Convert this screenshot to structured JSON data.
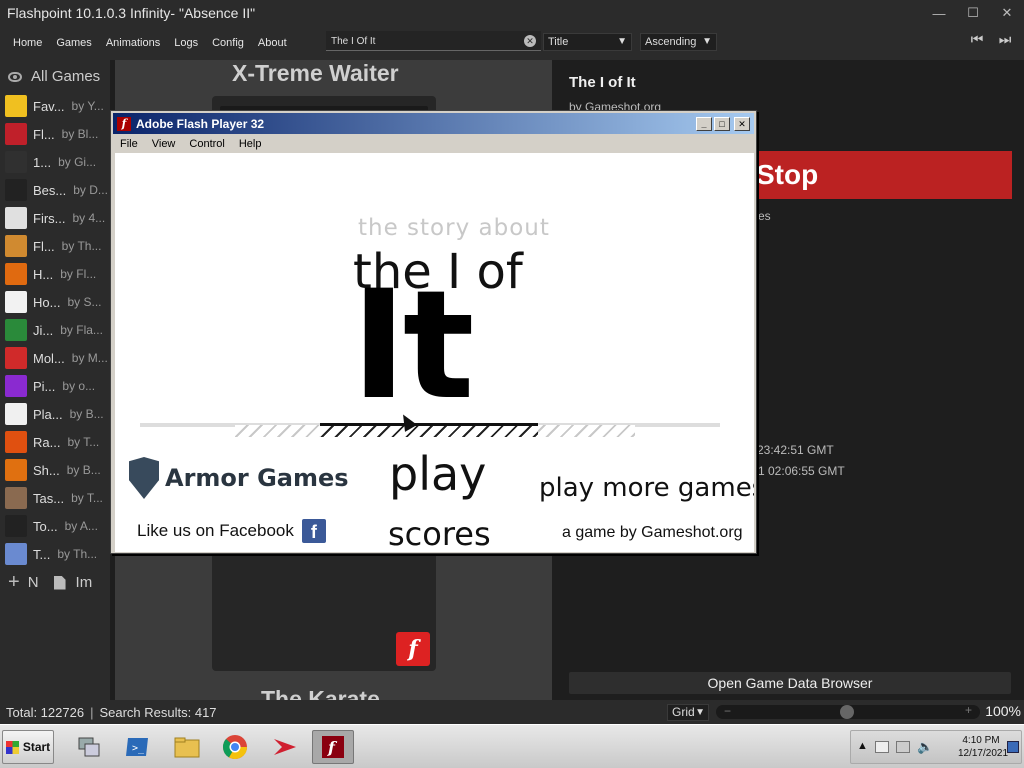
{
  "window": {
    "title": "Flashpoint 10.1.0.3 Infinity- \"Absence II\""
  },
  "menu": {
    "items": [
      "Home",
      "Games",
      "Animations",
      "Logs",
      "Config",
      "About"
    ],
    "search_value": "The I Of It",
    "sort_field": "Title",
    "sort_order": "Ascending"
  },
  "sidebar": {
    "all_games": "All Games",
    "playlists": [
      {
        "name": "Fav...",
        "by": "by Y...",
        "icon": "star-icon",
        "color": "#f0c020"
      },
      {
        "name": "Fl...",
        "by": "by Bl...",
        "icon": "flashpoint-icon",
        "color": "#c0202a"
      },
      {
        "name": "1...",
        "by": "by Gi...",
        "icon": "invader-icon",
        "color": "#303030"
      },
      {
        "name": "Bes...",
        "by": "by D...",
        "icon": "as-icon",
        "color": "#222222"
      },
      {
        "name": "Firs...",
        "by": "by 4...",
        "icon": "number-one-icon",
        "color": "#e0e0e0"
      },
      {
        "name": "Fl...",
        "by": "by Th...",
        "icon": "burger-icon",
        "color": "#d08a30"
      },
      {
        "name": "H...",
        "by": "by Fl...",
        "icon": "pumpkin-icon",
        "color": "#e06a10"
      },
      {
        "name": "Ho...",
        "by": "by S...",
        "icon": "santa-icon",
        "color": "#f2f2f2"
      },
      {
        "name": "Ji...",
        "by": "by Fla...",
        "icon": "tree-icon",
        "color": "#2a8a3a"
      },
      {
        "name": "Mol...",
        "by": "by M...",
        "icon": "molecule-icon",
        "color": "#d02a2a"
      },
      {
        "name": "Pi...",
        "by": "by o...",
        "icon": "pixel-icon",
        "color": "#8a2ad0"
      },
      {
        "name": "Pla...",
        "by": "by B...",
        "icon": "share-icon",
        "color": "#f0f0f0"
      },
      {
        "name": "Ra...",
        "by": "by T...",
        "icon": "flame-icon",
        "color": "#e05010"
      },
      {
        "name": "Sh...",
        "by": "by B...",
        "icon": "sound-icon",
        "color": "#e07010"
      },
      {
        "name": "Tas...",
        "by": "by T...",
        "icon": "character-icon",
        "color": "#8a6a50"
      },
      {
        "name": "To...",
        "by": "by A...",
        "icon": "figure-icon",
        "color": "#222222"
      },
      {
        "name": "T...",
        "by": "by Th...",
        "icon": "blocks-icon",
        "color": "#6a8ad0"
      }
    ],
    "new_label": "N",
    "import_label": "Im"
  },
  "grid": {
    "card_title": "X-Treme Waiter",
    "card_title_next": "The Karate"
  },
  "details": {
    "title": "The I of It",
    "by": "by Gameshot.org",
    "stop_label": "Stop",
    "frag_es": "es",
    "date1": "23:42:51 GMT",
    "date2": "1 02:06:55 GMT",
    "open_browser": "Open Game Data Browser"
  },
  "status": {
    "total": "Total: 122726",
    "search_results": "Search Results: 417",
    "view_mode": "Grid",
    "zoom": "100%"
  },
  "flash": {
    "title": "Adobe Flash Player 32",
    "menu": [
      "File",
      "View",
      "Control",
      "Help"
    ],
    "game": {
      "story": "the story about",
      "theiof": "the I of",
      "it": "It",
      "armor": "Armor Games",
      "facebook": "Like us on Facebook",
      "play": "play",
      "scores": "scores",
      "more": "play more games",
      "by": "a game by Gameshot.org"
    }
  },
  "taskbar": {
    "start": "Start",
    "time": "4:10 PM",
    "date": "12/17/2021"
  }
}
